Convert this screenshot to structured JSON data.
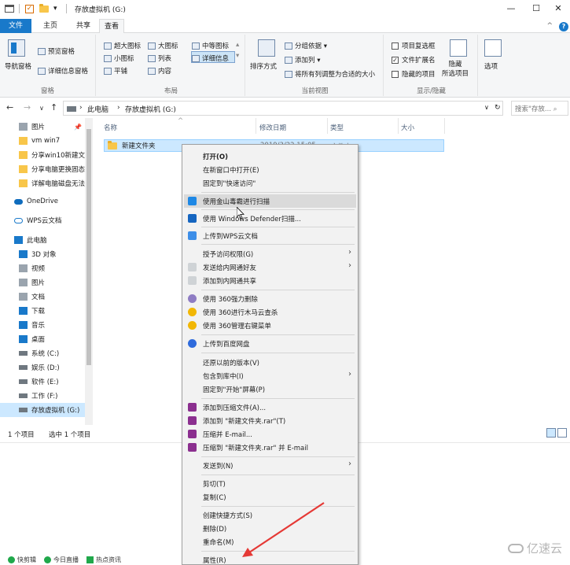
{
  "window": {
    "title": "存放虚拟机 (G:)",
    "minimize": "—",
    "maximize": "☐",
    "close": "✕"
  },
  "ribbon_tabs": {
    "file": "文件",
    "home": "主页",
    "share": "共享",
    "view": "查看",
    "collapse": "^",
    "help": "?"
  },
  "ribbon": {
    "panes": {
      "nav_pane": "导航窗格",
      "preview_pane": "预览窗格",
      "details_pane": "详细信息窗格",
      "label": "窗格"
    },
    "layout": {
      "items": [
        "超大图标",
        "大图标",
        "中等图标",
        "小图标",
        "列表",
        "详细信息",
        "平铺",
        "内容"
      ],
      "label": "布局"
    },
    "current_view": {
      "sort": "排序方式",
      "group_by": "分组依据 ▾",
      "add_column": "添加列 ▾",
      "fit_columns": "将所有列调整为合适的大小",
      "label": "当前视图"
    },
    "show_hide": {
      "item_checkboxes": "项目复选框",
      "file_extensions": "文件扩展名",
      "hidden_items": "隐藏的项目",
      "hide_selected": "隐藏\n所选项目",
      "label": "显示/隐藏"
    },
    "options": "选项"
  },
  "address": {
    "back": "←",
    "forward": "→",
    "recent": "∨",
    "up": "↑",
    "crumbs": [
      "此电脑",
      "›",
      "存放虚拟机 (G:)"
    ],
    "dropdown": "∨",
    "refresh": "↻",
    "search_placeholder": "搜索\"存放...  ⌕"
  },
  "nav_pane": {
    "quick_items": [
      {
        "label": "图片",
        "icon": "picture-icon",
        "pinned": true
      },
      {
        "label": "vm win7",
        "icon": "folder-icon"
      },
      {
        "label": "分享win10新建文",
        "icon": "folder-icon"
      },
      {
        "label": "分享电脑更换固态",
        "icon": "folder-icon"
      },
      {
        "label": "详解电脑磁盘无法",
        "icon": "folder-icon"
      }
    ],
    "onedrive": "OneDrive",
    "wps": "WPS云文档",
    "this_pc": "此电脑",
    "pc_items": [
      "3D 对象",
      "视频",
      "图片",
      "文档",
      "下载",
      "音乐",
      "桌面",
      "系统 (C:)",
      "娱乐 (D:)",
      "软件 (E:)",
      "工作 (F:)",
      "存放虚拟机 (G:)"
    ]
  },
  "list": {
    "columns": [
      "名称",
      "修改日期",
      "类型",
      "大小"
    ],
    "rows": [
      {
        "name": "新建文件夹",
        "date": "2019/3/22 15:05",
        "type": "文件夹"
      }
    ]
  },
  "status": {
    "count": "1 个项目",
    "selected": "选中 1 个项目"
  },
  "context_menu": {
    "items": [
      {
        "label": "打开(O)",
        "bold": true
      },
      {
        "label": "在新窗口中打开(E)"
      },
      {
        "label": "固定到\"快速访问\""
      },
      {
        "label": "使用金山毒霸进行扫描",
        "icon": "kingsoft-icon",
        "hover": true
      },
      {
        "label": "使用 Windows Defender扫描...",
        "icon": "defender-icon"
      },
      {
        "label": "上传到WPS云文档",
        "icon": "wps-cloud-icon"
      },
      {
        "label": "授予访问权限(G)",
        "submenu": true
      },
      {
        "label": "发送给内网通好友",
        "icon": "intranet-icon",
        "submenu": true
      },
      {
        "label": "添加到内网通共享",
        "icon": "intranet-icon"
      },
      {
        "label": "使用 360强力删除",
        "icon": "360-icon"
      },
      {
        "label": "使用 360进行木马云查杀",
        "icon": "360-icon"
      },
      {
        "label": "使用 360管理右键菜单",
        "icon": "360-icon"
      },
      {
        "label": "上传到百度网盘",
        "icon": "baidu-icon"
      },
      {
        "label": "还原以前的版本(V)"
      },
      {
        "label": "包含到库中(I)",
        "submenu": true
      },
      {
        "label": "固定到\"开始\"屏幕(P)"
      },
      {
        "label": "添加到压缩文件(A)...",
        "icon": "winrar-icon"
      },
      {
        "label": "添加到 \"新建文件夹.rar\"(T)",
        "icon": "winrar-icon"
      },
      {
        "label": "压缩并 E-mail...",
        "icon": "winrar-icon"
      },
      {
        "label": "压缩到 \"新建文件夹.rar\" 并 E-mail",
        "icon": "winrar-icon"
      },
      {
        "label": "发送到(N)",
        "submenu": true
      },
      {
        "label": "剪切(T)"
      },
      {
        "label": "复制(C)"
      },
      {
        "label": "创建快捷方式(S)"
      },
      {
        "label": "删除(D)"
      },
      {
        "label": "重命名(M)"
      },
      {
        "label": "属性(R)"
      }
    ]
  },
  "taskbar_strip": [
    "快剪辑",
    "今日直播",
    "热点资讯"
  ],
  "watermark": "亿速云",
  "colors": {
    "accent": "#1979ca",
    "selection": "#cce8ff",
    "menu_bg": "#f2f2f2",
    "arrow": "#e53935"
  }
}
